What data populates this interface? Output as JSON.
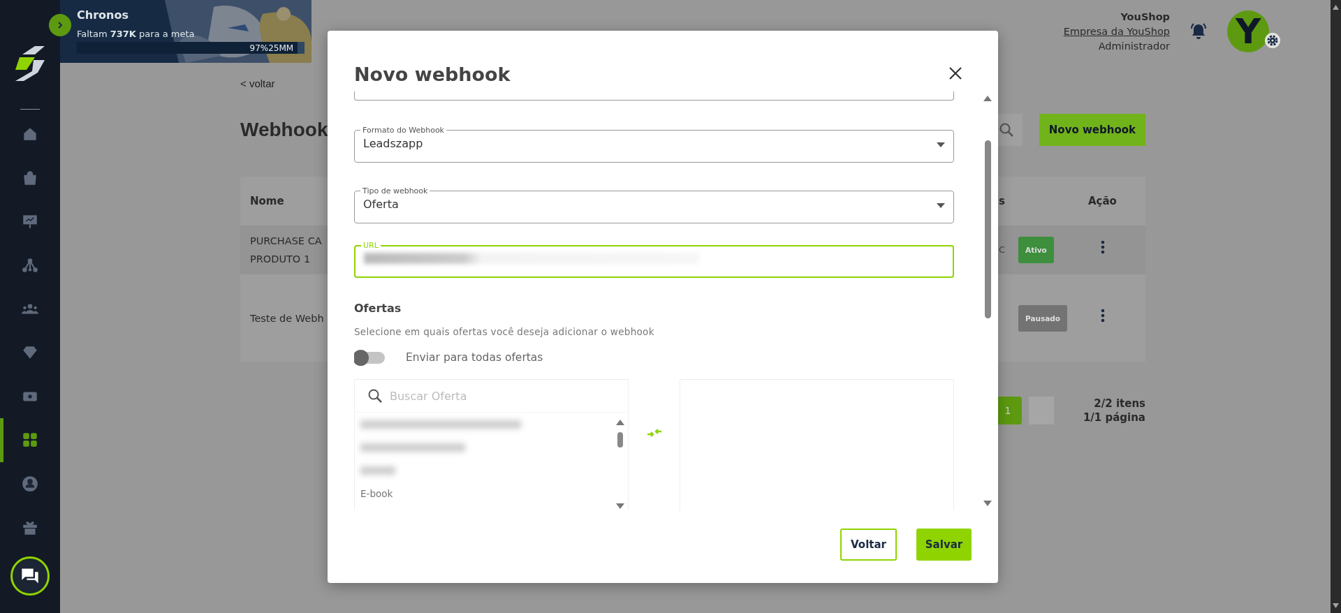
{
  "sidebar": {
    "items": [
      {
        "selected": false
      },
      {
        "selected": false
      },
      {
        "selected": false
      },
      {
        "selected": false
      },
      {
        "selected": false
      },
      {
        "selected": false
      },
      {
        "selected": false
      },
      {
        "selected": true
      },
      {
        "selected": false
      },
      {
        "selected": false
      }
    ]
  },
  "banner": {
    "title": "Chronos",
    "subtitle": "Faltam **737K** para a meta",
    "level": 0.97,
    "reading": "97%25MM"
  },
  "header": {
    "company": "YouShop",
    "link": "Empresa da YouShop",
    "role": "Administrador",
    "avatar": "Y"
  },
  "page": {
    "back": "< voltar",
    "title": "Webhook",
    "new_button": "Novo webhook",
    "table": {
      "columns": [
        "Nome",
        "s",
        "Ação"
      ],
      "rows": [
        {
          "name": "PURCHASE CA\nPRODUTO 1",
          "column_3": "C",
          "status": "Ativo",
          "color": "#3d8f3d"
        },
        {
          "name": "Teste de Webh",
          "status": "Pausado",
          "color": "#737373"
        }
      ]
    },
    "pagination": {
      "pages": [
        {
          "label": "1",
          "selected": true
        }
      ],
      "items": "2/2 itens",
      "page_count": "1/1 página"
    }
  },
  "modal": {
    "title": "Novo webhook",
    "fields": [
      {
        "kind": "select",
        "label": "Formato do Webhook",
        "value": "Leadszapp",
        "focused": false
      },
      {
        "kind": "select",
        "label": "Tipo de webhook",
        "value": "Oferta",
        "focused": false
      },
      {
        "kind": "text",
        "label": "URL",
        "blurred": true,
        "focused": true
      }
    ],
    "offers": {
      "title": "Ofertas",
      "description": "Selecione em quais ofertas você deseja adicionar o webhook",
      "toggle": {
        "label": "Enviar para todas ofertas",
        "on": false
      },
      "search_placeholder": "Buscar Oferta",
      "items": [
        {
          "kind": "blurred"
        },
        {
          "kind": "blurred"
        },
        {
          "kind": "blurred"
        },
        {
          "kind": "text",
          "label": "E-book"
        }
      ]
    },
    "buttons": [
      {
        "label": "Voltar",
        "kind": "secondary"
      },
      {
        "label": "Salvar",
        "kind": "primary"
      }
    ]
  }
}
